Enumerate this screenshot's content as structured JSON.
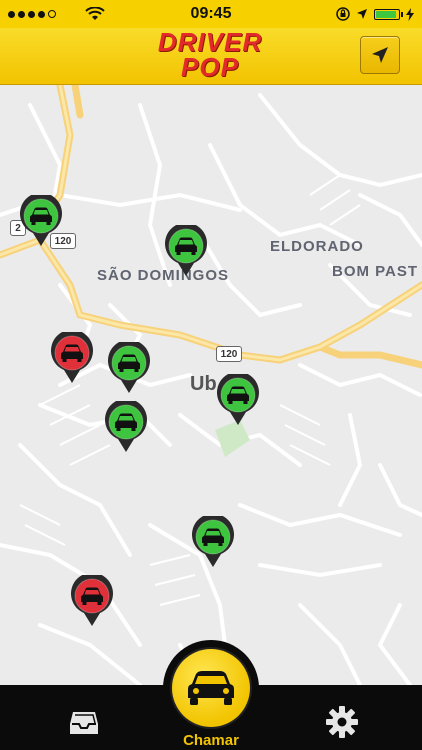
{
  "status_bar": {
    "time": "09:45",
    "signal_bars": 4,
    "signal_total": 5,
    "battery_level": 0.85
  },
  "header": {
    "logo_line1": "DRIVER",
    "logo_line2": "POP",
    "locate_icon": "location-arrow-icon"
  },
  "map": {
    "labels": {
      "sao_domingos": "SÃO DOMINGOS",
      "eldorado": "ELDORADO",
      "bom_pastor": "BOM PAST",
      "uba": "Ub"
    },
    "shields": {
      "road_a": "120",
      "road_b": "120",
      "road_c": "2"
    }
  },
  "drivers": [
    {
      "status": "available",
      "color": "#3ec43e"
    },
    {
      "status": "available",
      "color": "#3ec43e"
    },
    {
      "status": "busy",
      "color": "#e0303a"
    },
    {
      "status": "available",
      "color": "#3ec43e"
    },
    {
      "status": "available",
      "color": "#3ec43e"
    },
    {
      "status": "available",
      "color": "#3ec43e"
    },
    {
      "status": "available",
      "color": "#3ec43e"
    },
    {
      "status": "busy",
      "color": "#e0303a"
    }
  ],
  "bottom_bar": {
    "call_label": "Chamar",
    "inbox_icon": "inbox-icon",
    "settings_icon": "gear-icon",
    "call_icon": "car-icon"
  },
  "colors": {
    "brand_yellow": "#f2c400",
    "brand_red": "#e32a2a",
    "available": "#3ec43e",
    "busy": "#e0303a"
  }
}
